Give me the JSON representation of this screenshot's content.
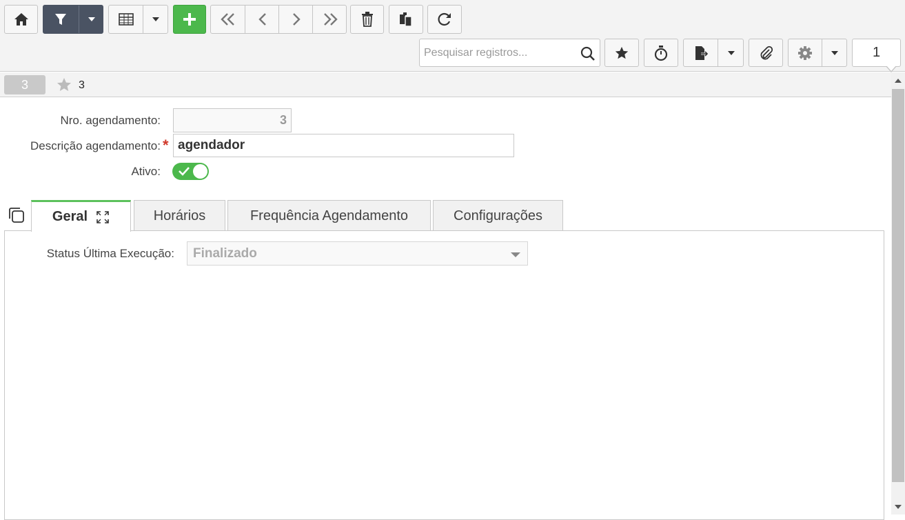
{
  "toolbar": {
    "search_placeholder": "Pesquisar registros...",
    "page_number": "1",
    "buttons": [
      "home",
      "filter",
      "filter-dropdown",
      "grid-view",
      "grid-view-dropdown",
      "add",
      "first",
      "previous",
      "next",
      "last",
      "delete",
      "copy",
      "refresh",
      "favorite",
      "timer",
      "export",
      "export-dropdown",
      "attach",
      "settings",
      "settings-dropdown"
    ]
  },
  "record": {
    "badge": "3",
    "title": "3"
  },
  "form": {
    "nro_label": "Nro. agendamento:",
    "nro_value": "3",
    "descricao_label": "Descrição agendamento:",
    "descricao_required": "*",
    "descricao_value": "agendador",
    "ativo_label": "Ativo:",
    "ativo_value": true
  },
  "tabs": [
    {
      "label": "Geral",
      "active": true
    },
    {
      "label": "Horários",
      "active": false
    },
    {
      "label": "Frequência Agendamento",
      "active": false
    },
    {
      "label": "Configurações",
      "active": false
    }
  ],
  "geral": {
    "status_label": "Status Última Execução:",
    "status_value": "Finalizado"
  },
  "colors": {
    "accent_green": "#4cb84c",
    "dark_button": "#4a5363",
    "required": "#d0382a"
  }
}
